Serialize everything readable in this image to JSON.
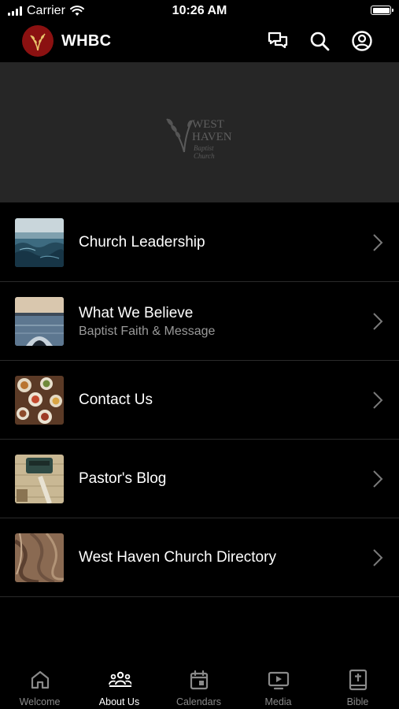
{
  "status_bar": {
    "carrier": "Carrier",
    "time": "10:26 AM"
  },
  "header": {
    "title": "WHBC",
    "brand_color": "#8b1111",
    "icons": [
      "messages-icon",
      "search-icon",
      "account-icon"
    ]
  },
  "banner": {
    "logo_line1": "WEST",
    "logo_line2": "HAVEN",
    "logo_line3": "Baptist Church"
  },
  "list": {
    "items": [
      {
        "title": "Church Leadership",
        "subtitle": ""
      },
      {
        "title": "What We Believe",
        "subtitle": "Baptist Faith & Message"
      },
      {
        "title": "Contact Us",
        "subtitle": ""
      },
      {
        "title": "Pastor's Blog",
        "subtitle": ""
      },
      {
        "title": "West Haven Church Directory",
        "subtitle": ""
      }
    ]
  },
  "tabs": [
    {
      "label": "Welcome",
      "icon": "home-icon",
      "active": false
    },
    {
      "label": "About Us",
      "icon": "people-icon",
      "active": true
    },
    {
      "label": "Calendars",
      "icon": "calendar-icon",
      "active": false
    },
    {
      "label": "Media",
      "icon": "media-icon",
      "active": false
    },
    {
      "label": "Bible",
      "icon": "bible-icon",
      "active": false
    }
  ]
}
